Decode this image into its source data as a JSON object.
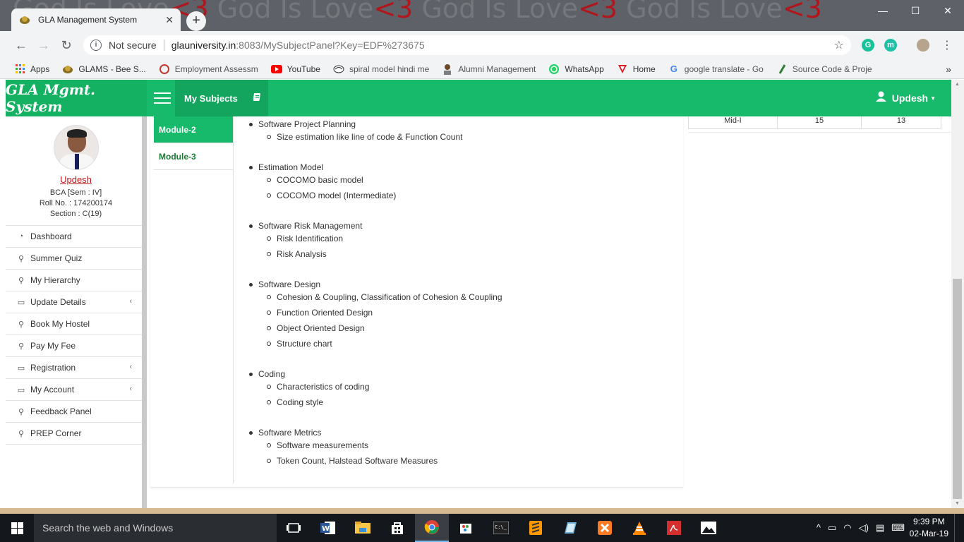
{
  "browser": {
    "wallpaper_text": "God Is Love",
    "wallpaper_heart": "<3",
    "tab_title": "GLA Management System",
    "address_security": "Not secure",
    "address_host": "glauniversity.in",
    "address_path": ":8083/MySubjectPanel?Key=EDF%273675",
    "extensions": [
      "G",
      "m"
    ],
    "bookmarks": [
      {
        "label": "Apps",
        "icon": "apps-grid-icon"
      },
      {
        "label": "GLAMS - Bee S...",
        "icon": "gla-logo-icon"
      },
      {
        "label": "Employment Assessm",
        "icon": "employment-icon"
      },
      {
        "label": "YouTube",
        "icon": "youtube-icon"
      },
      {
        "label": "spiral model hindi me",
        "icon": "spiral-icon"
      },
      {
        "label": "Alumni Management",
        "icon": "alumni-icon"
      },
      {
        "label": "WhatsApp",
        "icon": "whatsapp-icon"
      },
      {
        "label": "Home",
        "icon": "home-v-icon"
      },
      {
        "label": "google translate - Go",
        "icon": "google-icon"
      },
      {
        "label": "Source Code & Proje",
        "icon": "source-code-icon"
      }
    ]
  },
  "header": {
    "brand": "GLA Mgmt. System",
    "section": "My Subjects",
    "user": "Updesh"
  },
  "profile": {
    "name": "Updesh",
    "course": "BCA [Sem : IV]",
    "roll": "Roll No. : 174200174",
    "section": "Section : C(19)"
  },
  "sidebar": {
    "items": [
      {
        "label": "Dashboard",
        "icon": "dashboard-icon",
        "submenu": false
      },
      {
        "label": "Summer Quiz",
        "icon": "link-icon",
        "submenu": false
      },
      {
        "label": "My Hierarchy",
        "icon": "link-icon",
        "submenu": false
      },
      {
        "label": "Update Details",
        "icon": "laptop-icon",
        "submenu": true
      },
      {
        "label": "Book My Hostel",
        "icon": "link-icon",
        "submenu": false
      },
      {
        "label": "Pay My Fee",
        "icon": "link-icon",
        "submenu": false
      },
      {
        "label": "Registration",
        "icon": "laptop-icon",
        "submenu": true
      },
      {
        "label": "My Account",
        "icon": "laptop-icon",
        "submenu": true
      },
      {
        "label": "Feedback Panel",
        "icon": "link-icon",
        "submenu": false
      },
      {
        "label": "PREP Corner",
        "icon": "link-icon",
        "submenu": false
      }
    ]
  },
  "modules": {
    "tabs": [
      {
        "label": "Module-2",
        "active": true
      },
      {
        "label": "Module-3",
        "active": false
      }
    ]
  },
  "content": {
    "topics": [
      {
        "title": "Software Project Planning",
        "subs": [
          "Size estimation like line of code & Function Count"
        ]
      },
      {
        "title": "Estimation Model",
        "subs": [
          "COCOMO basic model",
          "COCOMO model (Intermediate)"
        ]
      },
      {
        "title": "Software Risk Management",
        "subs": [
          "Risk Identification",
          "Risk Analysis"
        ]
      },
      {
        "title": "Software Design",
        "subs": [
          "Cohesion & Coupling, Classification of Cohesion & Coupling",
          "Function Oriented Design",
          "Object Oriented Design",
          "Structure chart"
        ]
      },
      {
        "title": "Coding",
        "subs": [
          "Characteristics of coding",
          "Coding style"
        ]
      },
      {
        "title": "Software Metrics",
        "subs": [
          "Software measurements",
          "Token Count, Halstead Software Measures"
        ]
      }
    ]
  },
  "marks_table": {
    "row": [
      "Mid-I",
      "15",
      "13"
    ]
  },
  "taskbar": {
    "search_placeholder": "Search the web and Windows",
    "time": "9:39 PM",
    "date": "02-Mar-19"
  },
  "colors": {
    "brand_green": "#17b96a",
    "profile_red": "#c0141b"
  }
}
